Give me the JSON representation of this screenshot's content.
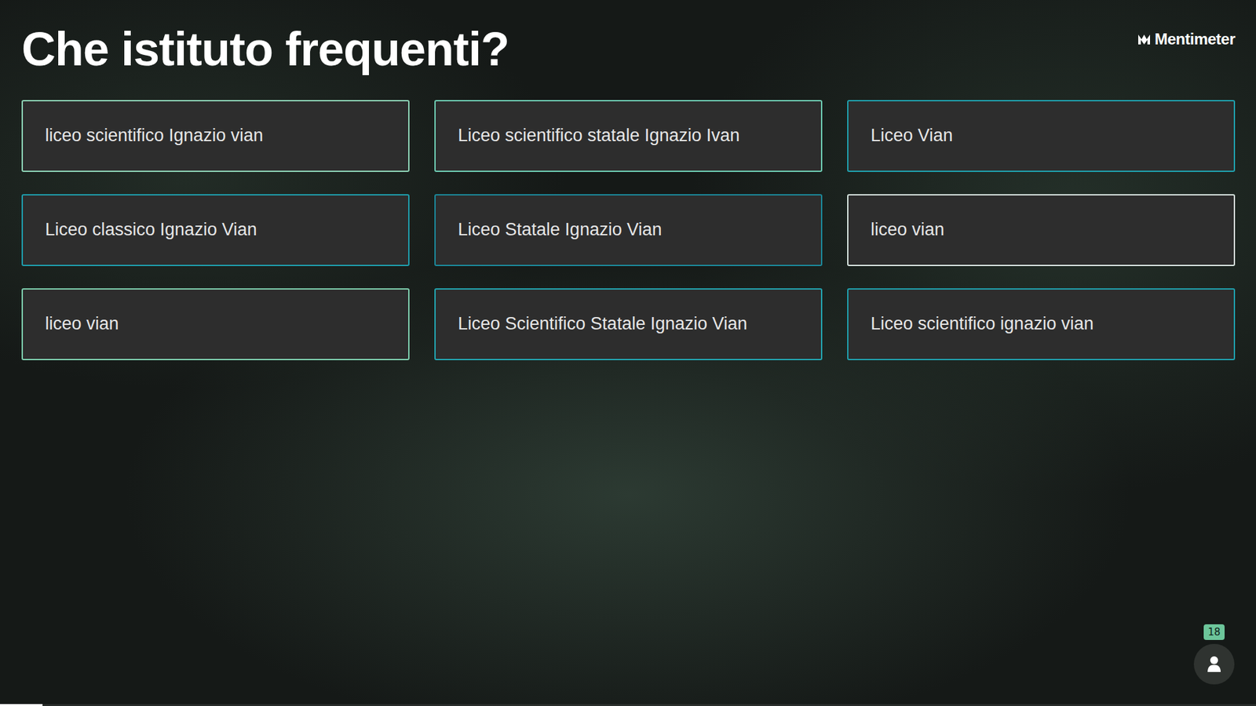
{
  "header": {
    "title": "Che istituto frequenti?",
    "logo": "Mentimeter"
  },
  "responses": [
    {
      "text": "liceo scientifico Ignazio vian",
      "color": "#8fd6b8"
    },
    {
      "text": "Liceo scientifico statale Ignazio Ivan",
      "color": "#6fcfb5"
    },
    {
      "text": "Liceo Vian",
      "color": "#1fa3b0"
    },
    {
      "text": "Liceo classico Ignazio Vian",
      "color": "#1e9fae"
    },
    {
      "text": "Liceo Statale Ignazio Vian",
      "color": "#1b8a9c"
    },
    {
      "text": "liceo vian",
      "color": "#d8e6e0"
    },
    {
      "text": "liceo vian",
      "color": "#7fd1b0"
    },
    {
      "text": "Liceo Scientifico Statale Ignazio Vian",
      "color": "#22a7b3"
    },
    {
      "text": "Liceo scientifico ignazio vian",
      "color": "#1fa3b0"
    }
  ],
  "participants": {
    "count": "18"
  },
  "progress": {
    "level": 0.034
  }
}
